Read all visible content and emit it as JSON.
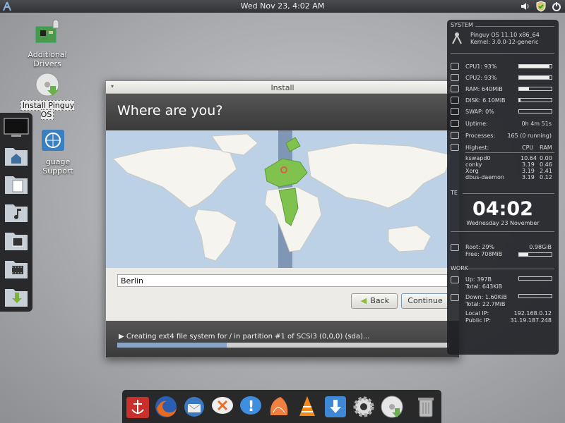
{
  "top_panel": {
    "clock": "Wed Nov 23,  4:02 AM",
    "logo_icon": "pinguy-logo-icon",
    "tray_icons": [
      "volume-icon",
      "shield-icon",
      "power-icon"
    ]
  },
  "desktop": {
    "icons": [
      {
        "label": "Additional Drivers",
        "icon": "circuit-board-icon"
      },
      {
        "label": "Install Pinguy OS",
        "icon": "disc-install-icon"
      },
      {
        "label": "guage Support",
        "icon": "globe-icon"
      }
    ]
  },
  "left_dock": {
    "items": [
      "monitor-icon",
      "home-folder-icon",
      "documents-folder-icon",
      "music-folder-icon",
      "pictures-folder-icon",
      "videos-folder-icon",
      "downloads-folder-icon"
    ]
  },
  "install_window": {
    "title": "Install",
    "menu_glyph": "▾",
    "close_glyph": "×",
    "heading": "Where are you?",
    "city_input_value": "Berlin",
    "back_label": "Back",
    "continue_label": "Continue",
    "status_text": "Creating ext4 file system for / in partition #1 of SCSI3 (0,0,0) (sda)...",
    "status_arrow": "▶",
    "progress_fraction": 0.33,
    "accent_colors": {
      "timezone_band": "#7f97b5",
      "selected_region": "#7fc24e",
      "map_ocean": "#bcd1e6",
      "marker": "#e25b4a"
    }
  },
  "conky": {
    "system_title": "SYSTEM",
    "os_name": "Pinguy OS 11.10 x86_64",
    "kernel": "Kernel: 3.0.0-12-generic",
    "cpu1_label": "CPU1: 93%",
    "cpu1": 0.93,
    "cpu2_label": "CPU2: 93%",
    "cpu2": 0.93,
    "ram_label": "RAM: 640MiB",
    "ram": 0.3,
    "disk_label": "DISK: 6.10MiB",
    "disk": 0.05,
    "swap_label": "SWAP: 0%",
    "swap": 0.0,
    "uptime_label": "Uptime:",
    "uptime_value": "0h 4m 51s",
    "processes_label": "Processes:",
    "processes_value": "165 (0 running)",
    "highest_label": "Highest:",
    "cpu_col": "CPU",
    "ram_col": "RAM",
    "procs": [
      {
        "name": "kswapd0",
        "cpu": "10.64",
        "ram": "0.00"
      },
      {
        "name": "conky",
        "cpu": "3.19",
        "ram": "0.46"
      },
      {
        "name": "Xorg",
        "cpu": "3.19",
        "ram": "2.41"
      },
      {
        "name": "dbus-daemon",
        "cpu": "3.19",
        "ram": "0.12"
      }
    ],
    "date_section": "TE",
    "time": "04:02",
    "date": "Wednesday 23 November",
    "root_label": "Root: 29%",
    "root_value": "0.98GiB",
    "root": 0.29,
    "free_label": "Free: 708MiB",
    "network_title": "WORK",
    "up_label": "Up: 397B",
    "up_total": "Total: 643KiB",
    "down_label": "Down: 1.60KiB",
    "down_total": "Total: 22.7MiB",
    "local_ip_label": "Local IP:",
    "local_ip": "192.168.0.12",
    "public_ip_label": "Public IP:",
    "public_ip": "31.19.187.248"
  },
  "bottom_dock": {
    "apps": [
      "anchor-icon",
      "firefox-icon",
      "thunderbird-icon",
      "chat-icon",
      "help-icon",
      "orange-app-icon",
      "vlc-icon",
      "download-icon",
      "settings-gear-icon",
      "disc-install-icon",
      "trash-icon"
    ]
  }
}
